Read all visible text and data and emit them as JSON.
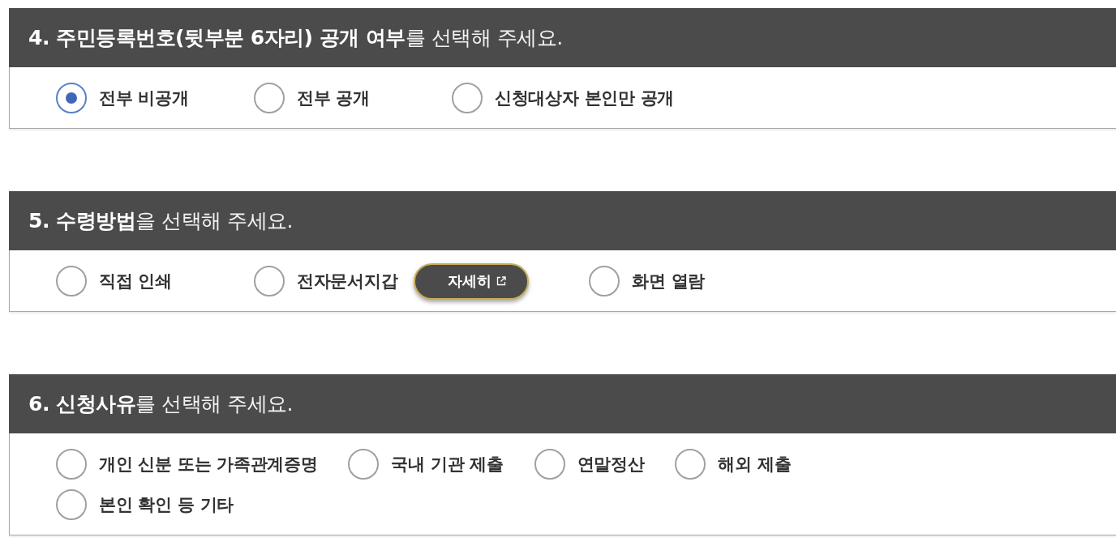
{
  "sections": [
    {
      "title": "**4. 주민등록번호(뒷부분 6자리) 공개 여부**를 선택해 주세요.",
      "options": [
        {
          "label": "전부 비공개",
          "selected": true
        },
        {
          "label": "전부 공개",
          "selected": false
        },
        {
          "label": "신청대상자 본인만 공개",
          "selected": false
        }
      ]
    },
    {
      "title": "**5. 수령방법**을 선택해 주세요.",
      "options": [
        {
          "label": "직접 인쇄",
          "selected": false
        },
        {
          "label": "전자문서지갑",
          "selected": false,
          "detail_button": "자세히"
        },
        {
          "label": "화면 열람",
          "selected": false
        }
      ]
    },
    {
      "title": "**6. 신청사유**를 선택해 주세요.",
      "options": [
        {
          "label": "개인 신분 또는 가족관계증명",
          "selected": false
        },
        {
          "label": "국내 기관 제출",
          "selected": false
        },
        {
          "label": "연말정산",
          "selected": false
        },
        {
          "label": "해외 제출",
          "selected": false
        },
        {
          "label": "본인 확인 등 기타",
          "selected": false
        }
      ]
    }
  ]
}
